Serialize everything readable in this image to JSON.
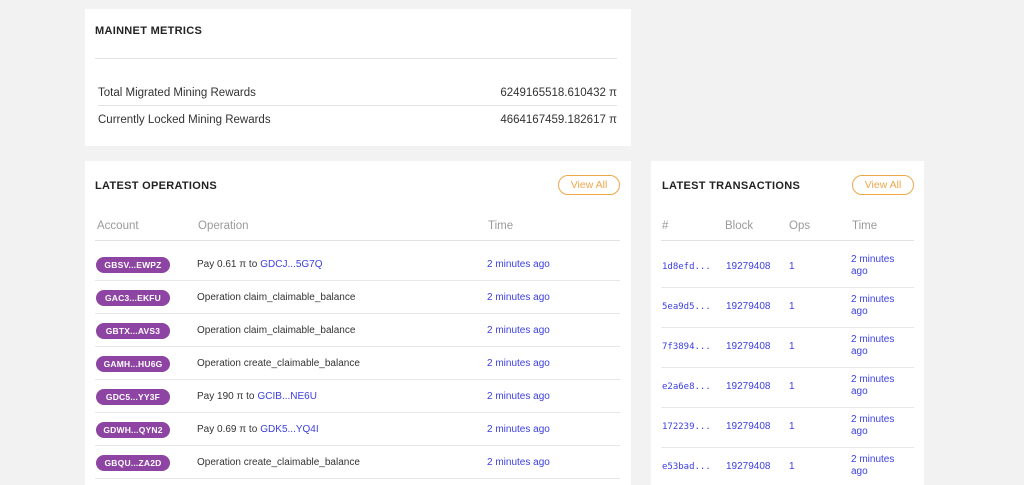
{
  "metrics": {
    "title": "MAINNET METRICS",
    "rows": [
      {
        "label": "Total Migrated Mining Rewards",
        "value": "6249165518.610432 π"
      },
      {
        "label": "Currently Locked Mining Rewards",
        "value": "4664167459.182617 π"
      }
    ]
  },
  "operations": {
    "title": "LATEST OPERATIONS",
    "view_all": "View All",
    "headers": {
      "account": "Account",
      "operation": "Operation",
      "time": "Time"
    },
    "rows": [
      {
        "account": "GBSV...EWPZ",
        "op": "Pay 0.61 π to",
        "link": "GDCJ...5G7Q",
        "time": "2 minutes ago"
      },
      {
        "account": "GAC3...EKFU",
        "op": "Operation claim_claimable_balance",
        "link": "",
        "time": "2 minutes ago"
      },
      {
        "account": "GBTX...AVS3",
        "op": "Operation claim_claimable_balance",
        "link": "",
        "time": "2 minutes ago"
      },
      {
        "account": "GAMH...HU6G",
        "op": "Operation create_claimable_balance",
        "link": "",
        "time": "2 minutes ago"
      },
      {
        "account": "GDC5...YY3F",
        "op": "Pay 190 π to",
        "link": "GCIB...NE6U",
        "time": "2 minutes ago"
      },
      {
        "account": "GDWH...QYN2",
        "op": "Pay 0.69 π to",
        "link": "GDK5...YQ4I",
        "time": "2 minutes ago"
      },
      {
        "account": "GBQU...ZA2D",
        "op": "Operation create_claimable_balance",
        "link": "",
        "time": "2 minutes ago"
      }
    ]
  },
  "transactions": {
    "title": "LATEST TRANSACTIONS",
    "view_all": "View All",
    "headers": {
      "hash": "#",
      "block": "Block",
      "ops": "Ops",
      "time": "Time"
    },
    "rows": [
      {
        "hash": "1d8efd...",
        "block": "19279408",
        "ops": "1",
        "time": "2 minutes ago"
      },
      {
        "hash": "5ea9d5...",
        "block": "19279408",
        "ops": "1",
        "time": "2 minutes ago"
      },
      {
        "hash": "7f3894...",
        "block": "19279408",
        "ops": "1",
        "time": "2 minutes ago"
      },
      {
        "hash": "e2a6e8...",
        "block": "19279408",
        "ops": "1",
        "time": "2 minutes ago"
      },
      {
        "hash": "172239...",
        "block": "19279408",
        "ops": "1",
        "time": "2 minutes ago"
      },
      {
        "hash": "e53bad...",
        "block": "19279408",
        "ops": "1",
        "time": "2 minutes ago"
      }
    ]
  },
  "colors": {
    "accent_orange": "#f0a64a",
    "link_blue": "#3b3ee0",
    "pill_purple": "#8d44a2"
  }
}
